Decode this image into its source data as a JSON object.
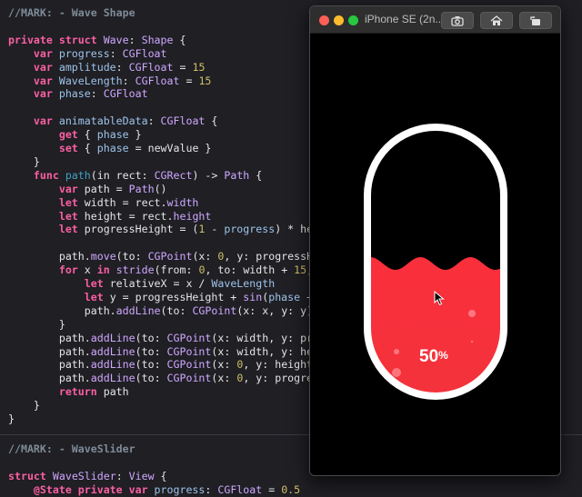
{
  "editor": {
    "lines": [
      [
        [
          "cm",
          "//MARK: - Wave Shape"
        ]
      ],
      [],
      [
        [
          "kw",
          "private struct "
        ],
        [
          "ty",
          "Wave"
        ],
        [
          "pl",
          ": "
        ],
        [
          "ty",
          "Shape"
        ],
        [
          "pl",
          " {"
        ]
      ],
      [
        [
          "pl",
          "    "
        ],
        [
          "kw",
          "var "
        ],
        [
          "pr",
          "progress"
        ],
        [
          "pl",
          ": "
        ],
        [
          "ty",
          "CGFloat"
        ]
      ],
      [
        [
          "pl",
          "    "
        ],
        [
          "kw",
          "var "
        ],
        [
          "pr",
          "amplitude"
        ],
        [
          "pl",
          ": "
        ],
        [
          "ty",
          "CGFloat"
        ],
        [
          "pl",
          " = "
        ],
        [
          "nu",
          "15"
        ]
      ],
      [
        [
          "pl",
          "    "
        ],
        [
          "kw",
          "var "
        ],
        [
          "pr",
          "WaveLength"
        ],
        [
          "pl",
          ": "
        ],
        [
          "ty",
          "CGFloat"
        ],
        [
          "pl",
          " = "
        ],
        [
          "nu",
          "15"
        ]
      ],
      [
        [
          "pl",
          "    "
        ],
        [
          "kw",
          "var "
        ],
        [
          "pr",
          "phase"
        ],
        [
          "pl",
          ": "
        ],
        [
          "ty",
          "CGFloat"
        ]
      ],
      [],
      [
        [
          "pl",
          "    "
        ],
        [
          "kw",
          "var "
        ],
        [
          "pr",
          "animatableData"
        ],
        [
          "pl",
          ": "
        ],
        [
          "ty",
          "CGFloat"
        ],
        [
          "pl",
          " {"
        ]
      ],
      [
        [
          "pl",
          "        "
        ],
        [
          "kw",
          "get"
        ],
        [
          "pl",
          " { "
        ],
        [
          "pr",
          "phase"
        ],
        [
          "pl",
          " }"
        ]
      ],
      [
        [
          "pl",
          "        "
        ],
        [
          "kw",
          "set"
        ],
        [
          "pl",
          " { "
        ],
        [
          "pr",
          "phase"
        ],
        [
          "pl",
          " = newValue }"
        ]
      ],
      [
        [
          "pl",
          "    }"
        ]
      ],
      [
        [
          "pl",
          "    "
        ],
        [
          "kw",
          "func "
        ],
        [
          "fn",
          "path"
        ],
        [
          "pl",
          "(in rect: "
        ],
        [
          "ty",
          "CGRect"
        ],
        [
          "pl",
          ") -> "
        ],
        [
          "ty",
          "Path"
        ],
        [
          "pl",
          " {"
        ]
      ],
      [
        [
          "pl",
          "        "
        ],
        [
          "kw",
          "var "
        ],
        [
          "pl",
          "path = "
        ],
        [
          "ty",
          "Path"
        ],
        [
          "pl",
          "()"
        ]
      ],
      [
        [
          "pl",
          "        "
        ],
        [
          "kw",
          "let "
        ],
        [
          "pl",
          "width = rect."
        ],
        [
          "ty",
          "width"
        ]
      ],
      [
        [
          "pl",
          "        "
        ],
        [
          "kw",
          "let "
        ],
        [
          "pl",
          "height = rect."
        ],
        [
          "ty",
          "height"
        ]
      ],
      [
        [
          "pl",
          "        "
        ],
        [
          "kw",
          "let "
        ],
        [
          "pl",
          "progressHeight = ("
        ],
        [
          "nu",
          "1"
        ],
        [
          "pl",
          " - "
        ],
        [
          "pr",
          "progress"
        ],
        [
          "pl",
          ") * hei"
        ]
      ],
      [],
      [
        [
          "pl",
          "        path."
        ],
        [
          "ty",
          "move"
        ],
        [
          "pl",
          "(to: "
        ],
        [
          "ty",
          "CGPoint"
        ],
        [
          "pl",
          "(x: "
        ],
        [
          "nu",
          "0"
        ],
        [
          "pl",
          ", y: progressHe"
        ]
      ],
      [
        [
          "pl",
          "        "
        ],
        [
          "kw",
          "for "
        ],
        [
          "pl",
          "x "
        ],
        [
          "kw",
          "in "
        ],
        [
          "ty",
          "stride"
        ],
        [
          "pl",
          "(from: "
        ],
        [
          "nu",
          "0"
        ],
        [
          "pl",
          ", to: width + "
        ],
        [
          "nu",
          "15"
        ],
        [
          "pl",
          ","
        ]
      ],
      [
        [
          "pl",
          "            "
        ],
        [
          "kw",
          "let "
        ],
        [
          "pl",
          "relativeX = x / "
        ],
        [
          "pr",
          "WaveLength"
        ]
      ],
      [
        [
          "pl",
          "            "
        ],
        [
          "kw",
          "let "
        ],
        [
          "pl",
          "y = progressHeight + "
        ],
        [
          "ty",
          "sin"
        ],
        [
          "pl",
          "("
        ],
        [
          "pr",
          "phase"
        ],
        [
          "pl",
          " +"
        ]
      ],
      [
        [
          "pl",
          "            path."
        ],
        [
          "ty",
          "addLine"
        ],
        [
          "pl",
          "(to: "
        ],
        [
          "ty",
          "CGPoint"
        ],
        [
          "pl",
          "(x: x, y: y))"
        ]
      ],
      [
        [
          "pl",
          "        }"
        ]
      ],
      [
        [
          "pl",
          "        path."
        ],
        [
          "ty",
          "addLine"
        ],
        [
          "pl",
          "(to: "
        ],
        [
          "ty",
          "CGPoint"
        ],
        [
          "pl",
          "(x: width, y: pro"
        ]
      ],
      [
        [
          "pl",
          "        path."
        ],
        [
          "ty",
          "addLine"
        ],
        [
          "pl",
          "(to: "
        ],
        [
          "ty",
          "CGPoint"
        ],
        [
          "pl",
          "(x: width, y: hei"
        ]
      ],
      [
        [
          "pl",
          "        path."
        ],
        [
          "ty",
          "addLine"
        ],
        [
          "pl",
          "(to: "
        ],
        [
          "ty",
          "CGPoint"
        ],
        [
          "pl",
          "(x: "
        ],
        [
          "nu",
          "0"
        ],
        [
          "pl",
          ", y: height)"
        ]
      ],
      [
        [
          "pl",
          "        path."
        ],
        [
          "ty",
          "addLine"
        ],
        [
          "pl",
          "(to: "
        ],
        [
          "ty",
          "CGPoint"
        ],
        [
          "pl",
          "(x: "
        ],
        [
          "nu",
          "0"
        ],
        [
          "pl",
          ", y: progres"
        ]
      ],
      [
        [
          "pl",
          "        "
        ],
        [
          "kw",
          "return "
        ],
        [
          "pl",
          "path"
        ]
      ],
      [
        [
          "pl",
          "    }"
        ]
      ],
      [
        [
          "pl",
          "}"
        ]
      ],
      [],
      [
        [
          "cm",
          "//MARK: - WaveSlider"
        ]
      ],
      [],
      [
        [
          "kw",
          "struct "
        ],
        [
          "ty",
          "WaveSlider"
        ],
        [
          "pl",
          ": "
        ],
        [
          "ty",
          "View"
        ],
        [
          "pl",
          " {"
        ]
      ],
      [
        [
          "pl",
          "    "
        ],
        [
          "kw",
          "@State private var "
        ],
        [
          "pr",
          "progress"
        ],
        [
          "pl",
          ": "
        ],
        [
          "ty",
          "CGFloat"
        ],
        [
          "pl",
          " = "
        ],
        [
          "nu",
          "0.5"
        ]
      ]
    ]
  },
  "simulator": {
    "title": "iPhone SE (2n...",
    "toolbar": [
      {
        "name": "screenshot-button",
        "icon": "camera-icon"
      },
      {
        "name": "home-button",
        "icon": "home-icon"
      },
      {
        "name": "rotate-button",
        "icon": "rotate-icon"
      }
    ],
    "traffic_lights": {
      "close": "#fe5f57",
      "minimize": "#febc2e",
      "zoom": "#28c840"
    }
  },
  "slider": {
    "value_text": "50",
    "unit": "%",
    "progress": 0.5,
    "fill_color_top": "#fa2f3c",
    "fill_color_bottom": "#f3323b",
    "border_color": "#ffffff"
  }
}
